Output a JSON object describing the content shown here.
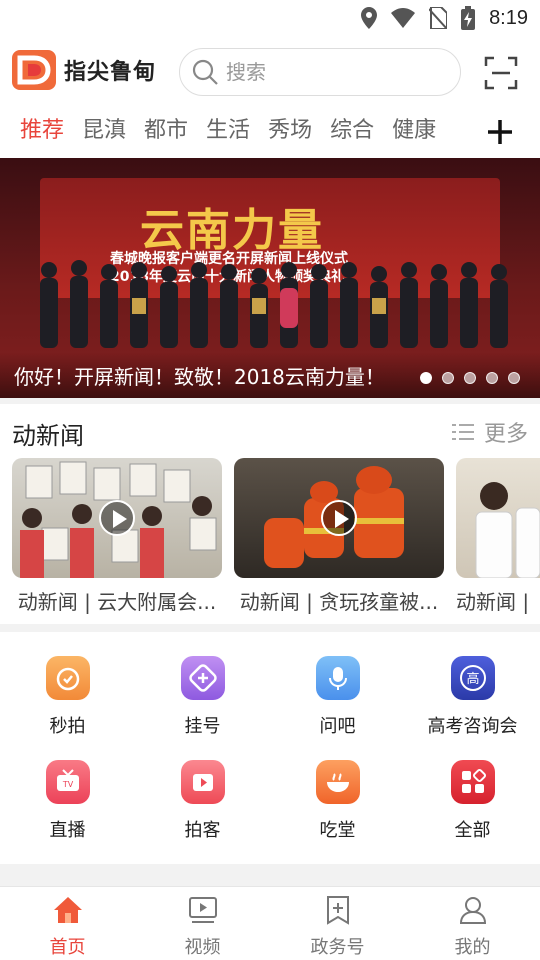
{
  "status_bar": {
    "time": "8:19"
  },
  "header": {
    "app_name": "指尖鲁甸",
    "search_placeholder": "搜索"
  },
  "tabs": [
    {
      "label": "推荐",
      "active": true
    },
    {
      "label": "昆滇",
      "active": false
    },
    {
      "label": "都市",
      "active": false
    },
    {
      "label": "生活",
      "active": false
    },
    {
      "label": "秀场",
      "active": false
    },
    {
      "label": "综合",
      "active": false
    },
    {
      "label": "健康",
      "active": false
    }
  ],
  "banner": {
    "stage_title": "云南力量",
    "stage_line1": "春城晚报客户端更名开屏新闻上线仪式",
    "stage_line2": "2018年度云南十大新闻人物颁奖典礼",
    "caption": "你好！开屏新闻！致敬！2018云南力量！",
    "slide_count": 5,
    "active_slide": 1
  },
  "news_section": {
    "title": "动新闻",
    "more_label": "更多",
    "videos": [
      {
        "title": "动新闻 | 云大附属会..."
      },
      {
        "title": "动新闻 | 贪玩孩童被..."
      },
      {
        "title": "动新闻 |"
      }
    ]
  },
  "services": [
    {
      "label": "秒拍",
      "icon": "stopwatch-icon",
      "color": "#f7a04a"
    },
    {
      "label": "挂号",
      "icon": "plus-tag-icon",
      "color": "#a874e6"
    },
    {
      "label": "问吧",
      "icon": "microphone-icon",
      "color": "#59a8f0"
    },
    {
      "label": "高考咨询会",
      "icon": "gaokao-icon",
      "color": "#3d4fc9"
    },
    {
      "label": "直播",
      "icon": "tv-icon",
      "color": "#f25a6a"
    },
    {
      "label": "拍客",
      "icon": "video-play-icon",
      "color": "#f5626b"
    },
    {
      "label": "吃堂",
      "icon": "bowl-icon",
      "color": "#f7824a"
    },
    {
      "label": "全部",
      "icon": "grid-apps-icon",
      "color": "#e8313c"
    }
  ],
  "bottom_nav": [
    {
      "label": "首页",
      "active": true
    },
    {
      "label": "视频",
      "active": false
    },
    {
      "label": "政务号",
      "active": false
    },
    {
      "label": "我的",
      "active": false
    }
  ]
}
